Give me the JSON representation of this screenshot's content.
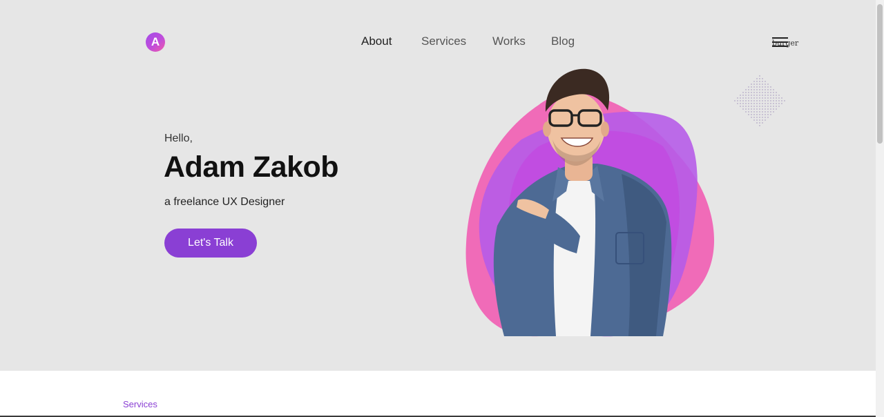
{
  "logo": {
    "letter": "A"
  },
  "nav": {
    "items": [
      {
        "label": "About",
        "active": true
      },
      {
        "label": "Services",
        "active": false
      },
      {
        "label": "Works",
        "active": false
      },
      {
        "label": "Blog",
        "active": false
      }
    ]
  },
  "menu_toggle": {
    "alt_text": "burger",
    "icon": "hamburger-menu-icon"
  },
  "hero": {
    "greeting": "Hello,",
    "name": "Adam Zakob",
    "subtitle": "a freelance UX Designer",
    "cta_label": "Let's Talk"
  },
  "next_section": {
    "label": "Services"
  },
  "colors": {
    "accent": "#8a3fd4",
    "pink": "#f06bb8",
    "purple": "#b65ce8",
    "hero_bg": "#e6e6e6"
  }
}
